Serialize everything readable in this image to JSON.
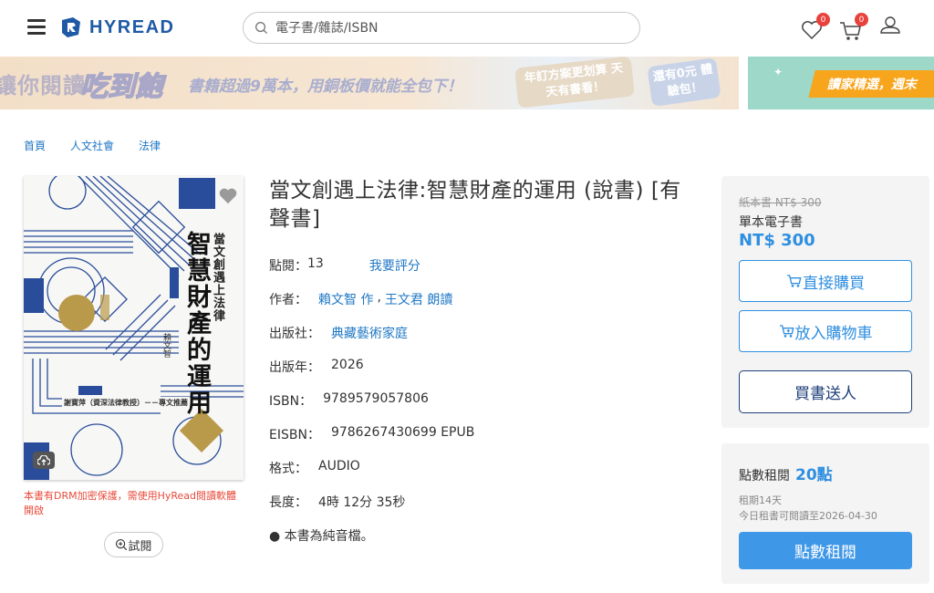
{
  "header": {
    "logo_text": "HYREAD",
    "search_placeholder": "電子書/雜誌/ISBN",
    "wishlist_count": "0",
    "cart_count": "0"
  },
  "banner": {
    "text_part1": "讓你閱讀",
    "text_highlight": "吃到飽",
    "text_part2": "書籍超過9萬本，用銅板價就能全包下！",
    "badge1": "年訂方案更划算 天天有書看！",
    "badge2": "還有0元 體驗包！",
    "side_text": "讀家精選，週末"
  },
  "breadcrumb": [
    "首頁",
    "人文社會",
    "法律"
  ],
  "cover": {
    "title_small": "當文創遇上法律",
    "title_large": "智慧財產的運用",
    "author_line": "賴文智",
    "blurb": "謝寶萍（資深法律教授）－－專文推薦"
  },
  "drm_note": "本書有DRM加密保護，需使用HyRead閱讀軟體開啟",
  "trial_label": "試閱",
  "book": {
    "title": "當文創遇上法律:智慧財產的運用 (說書) [有聲書]",
    "views_label": "點閱：",
    "views": "13",
    "rate_link": "我要評分",
    "author_label": "作者：",
    "author": "賴文智 作",
    "narrator": "王文君 朗讀",
    "publisher_label": "出版社：",
    "publisher": "典藏藝術家庭",
    "year_label": "出版年：",
    "year": "2026",
    "isbn_label": "ISBN：",
    "isbn": "9789579057806",
    "eisbn_label": "EISBN：",
    "eisbn": "9786267430699 EPUB",
    "format_label": "格式：",
    "format": "AUDIO",
    "length_label": "長度：",
    "length": "4時 12分 35秒",
    "audio_note": "● 本書為純音檔。"
  },
  "purchase": {
    "paper_price": "紙本書 NT$ 300",
    "type": "單本電子書",
    "price": "NT$ 300",
    "buy_now": "直接購買",
    "add_cart": "放入購物車",
    "gift": "買書送人"
  },
  "rent": {
    "label": "點數租閱",
    "points": "20點",
    "period": "租期14天",
    "until": "今日租書可閱讀至2026-04-30",
    "button": "點數租閱"
  },
  "colors": {
    "brand_blue": "#1e5aa6",
    "accent_blue": "#2f8fe0",
    "warning_red": "#e84a3a",
    "badge_red": "#e8423b"
  }
}
